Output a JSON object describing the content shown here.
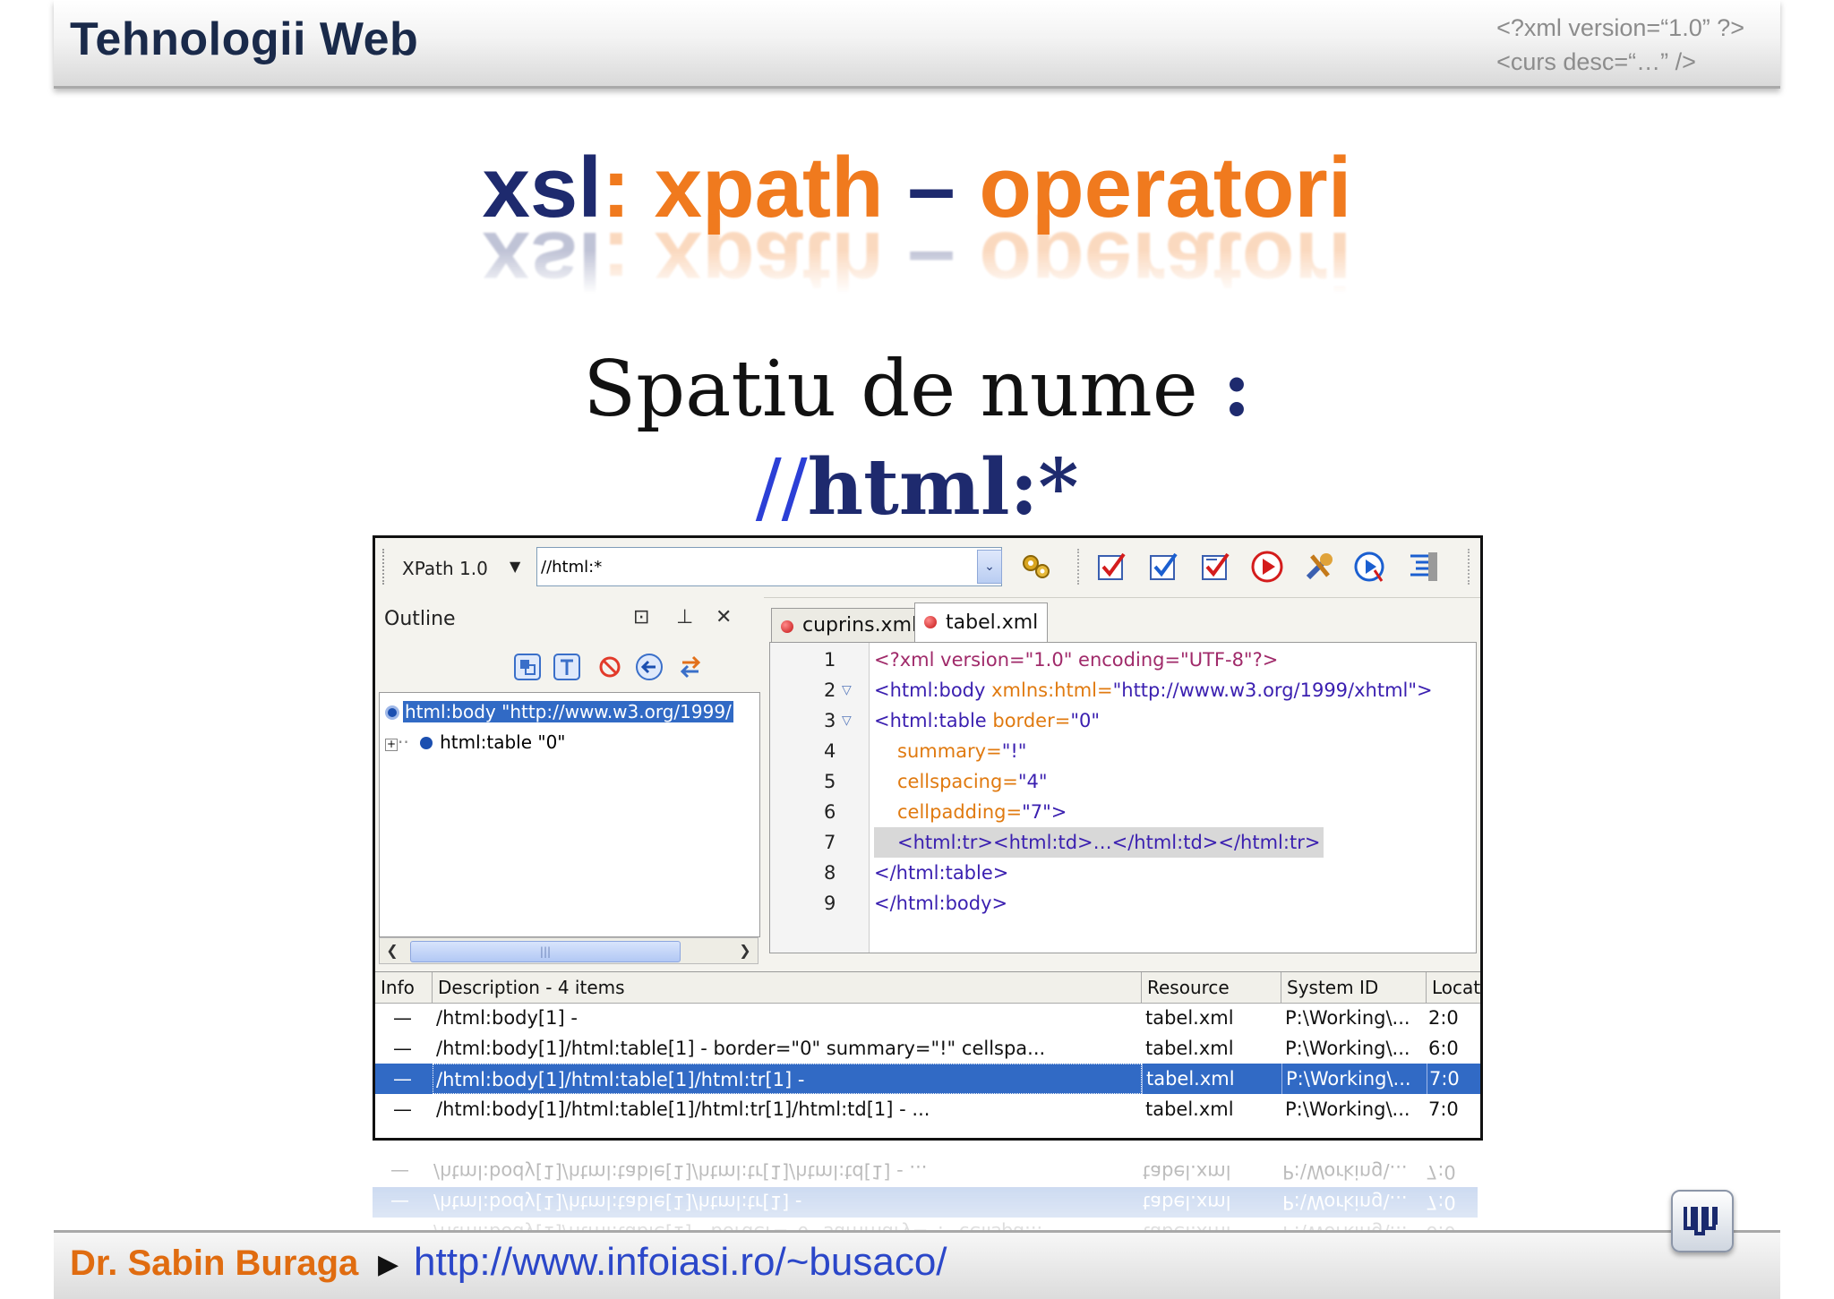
{
  "header": {
    "title": "Tehnologii Web",
    "meta_line1": "<?xml version=“1.0” ?>",
    "meta_line2": "<curs desc=“…” />"
  },
  "slide": {
    "title_xsl": "xsl",
    "title_colon": ":",
    "title_xpath": "xpath",
    "title_dash": "–",
    "title_operatori": "operatori",
    "subtitle_text": "Spatiu de nume",
    "subtitle_colon": ":",
    "expr_slashes": "//",
    "expr_rest": "html:*"
  },
  "toolbar": {
    "xpath_version": "XPath 1.0",
    "xpath_value": "//html:*",
    "icons": [
      "gears-icon",
      "validate-check-icon",
      "check-icon",
      "check-list-icon",
      "run-icon",
      "tools-icon",
      "debug-icon",
      "format-icon"
    ]
  },
  "outline": {
    "title": "Outline",
    "restore": "⊡",
    "pin": "⊥",
    "close": "✕",
    "tree": [
      {
        "label": "html:body \"http://www.w3.org/1999/",
        "selected": true
      },
      {
        "label": "html:table \"0\"",
        "selected": false
      }
    ],
    "scroll_grip": "|||"
  },
  "editor": {
    "tabs": [
      {
        "label": "cuprins.xml",
        "active": false
      },
      {
        "label": "tabel.xml",
        "active": true
      }
    ],
    "line_numbers": [
      "1",
      "2",
      "3",
      "4",
      "5",
      "6",
      "7",
      "8",
      "9"
    ],
    "lines": {
      "l1": "<?xml version=\"1.0\" encoding=\"UTF-8\"?>",
      "l2_tag": "<html:body",
      "l2_attr": " xmlns:html=",
      "l2_val": "\"http://www.w3.org/1999/xhtml\">",
      "l3_tag": "<html:table",
      "l3_attr": " border=",
      "l3_val": "\"0\"",
      "l4_attr": "summary=",
      "l4_val": "\"!\"",
      "l5_attr": "cellspacing=",
      "l5_val": "\"4\"",
      "l6_attr": "cellpadding=",
      "l6_val": "\"7\">",
      "l7": "<html:tr><html:td>…</html:td></html:tr>",
      "l8": "</html:table>",
      "l9": "</html:body>"
    }
  },
  "results": {
    "headers": {
      "info": "Info",
      "description": "Description - 4 items",
      "resource": "Resource",
      "system_id": "System ID",
      "location": "Location"
    },
    "rows": [
      {
        "info": "—",
        "description": "/html:body[1] -",
        "resource": "tabel.xml",
        "system_id": "P:\\Working\\...",
        "location": "2:0"
      },
      {
        "info": "—",
        "description": "/html:body[1]/html:table[1] - border=\"0\" summary=\"!\" cellspa...",
        "resource": "tabel.xml",
        "system_id": "P:\\Working\\...",
        "location": "6:0"
      },
      {
        "info": "—",
        "description": "/html:body[1]/html:table[1]/html:tr[1] -",
        "resource": "tabel.xml",
        "system_id": "P:\\Working\\...",
        "location": "7:0"
      },
      {
        "info": "—",
        "description": "/html:body[1]/html:table[1]/html:tr[1]/html:td[1] - ...",
        "resource": "tabel.xml",
        "system_id": "P:\\Working\\...",
        "location": "7:0"
      }
    ],
    "selected_row": 2
  },
  "footer": {
    "author": "Dr. Sabin Buraga",
    "arrow": "▶",
    "url": "http://www.infoiasi.ro/~busaco/"
  },
  "colors": {
    "title_blue": "#1e2a6e",
    "title_orange": "#f07a1e",
    "selection": "#316ac5",
    "link": "#2b47c9"
  }
}
